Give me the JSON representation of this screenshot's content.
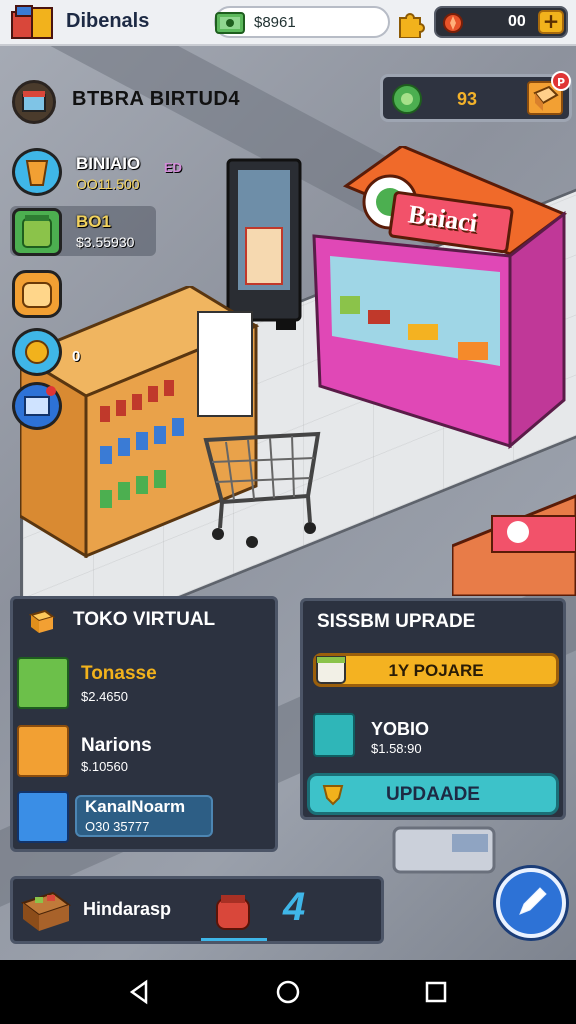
{
  "topbar": {
    "app_title": "Dibenals",
    "cash_value": "$8961",
    "gem_value": "00",
    "gem_add_label": "+"
  },
  "store": {
    "name": "BTBRA BIRTUD4",
    "level_value": "93",
    "notif_count": "P"
  },
  "resources": [
    {
      "title": "BINIAIO",
      "sub": "OO11.500",
      "badge": "ED"
    },
    {
      "title": "BO1",
      "sub": "$3.55930",
      "badge": ""
    }
  ],
  "side_mark": "0",
  "shop_sign": "Baiaci",
  "toko_panel": {
    "title": "TOKO VIRTUAL",
    "items": [
      {
        "name": "Tonasse",
        "price": "$2.4650"
      },
      {
        "name": "Narions",
        "price": "$.10560"
      },
      {
        "name": "KanaINoarm",
        "price": "O30 35777"
      }
    ]
  },
  "upgrade_panel": {
    "title": "SISSBM UPRADE",
    "upgrade_label": "1Y POJARE",
    "item_name": "YOBIO",
    "item_price": "$1.58:90",
    "button_label": "UPDAADE"
  },
  "bottom_bar": {
    "label": "Hindarasp",
    "slot_number": "4"
  },
  "colors": {
    "accent_gold": "#f4b221",
    "accent_teal": "#3dc2c9",
    "panel_bg": "#2c3240",
    "gem_text": "#f3b22a"
  },
  "icons": {
    "fab": "pencil-icon",
    "nav": [
      "back-icon",
      "home-icon",
      "recents-icon"
    ]
  }
}
